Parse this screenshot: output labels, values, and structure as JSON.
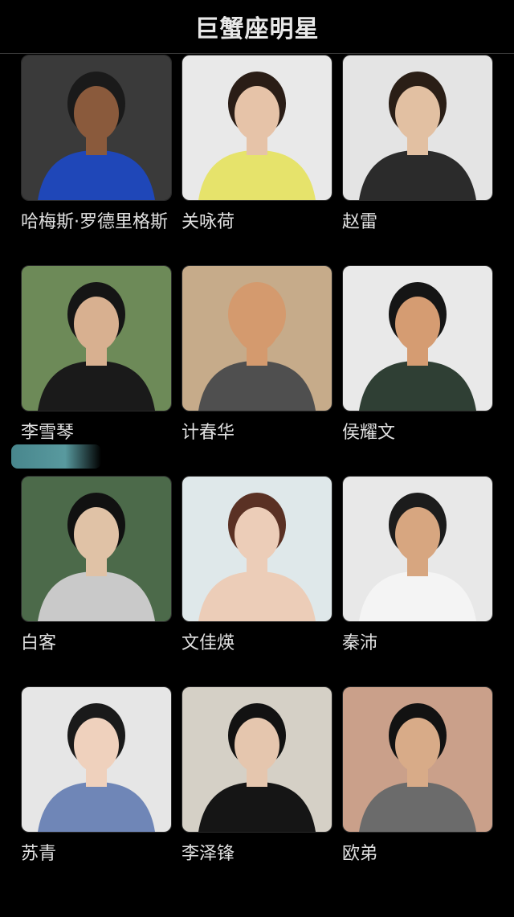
{
  "header": {
    "title": "巨蟹座明星"
  },
  "celebrities": [
    {
      "name": "哈梅斯·罗德里格斯",
      "photo": {
        "bg": "#3a3a3a",
        "skin": "#8a5a3c",
        "hair": "#1a1a1a",
        "shirt": "#1f47b8"
      }
    },
    {
      "name": "关咏荷",
      "photo": {
        "bg": "#e9e9e9",
        "skin": "#e6c3a8",
        "hair": "#2a1d16",
        "shirt": "#e6e36b"
      }
    },
    {
      "name": "赵雷",
      "photo": {
        "bg": "#e4e4e4",
        "skin": "#e2c0a2",
        "hair": "#2a1e16",
        "shirt": "#2b2b2b"
      }
    },
    {
      "name": "李雪琴",
      "photo": {
        "bg": "#6d8a58",
        "skin": "#d8b090",
        "hair": "#151515",
        "shirt": "#1a1a1a"
      }
    },
    {
      "name": "计春华",
      "photo": {
        "bg": "#c6ab8a",
        "skin": "#d49a6e",
        "hair": "#d49a6e",
        "shirt": "#4f4f4f"
      }
    },
    {
      "name": "侯耀文",
      "photo": {
        "bg": "#e9e9e9",
        "skin": "#d59c72",
        "hair": "#151515",
        "shirt": "#2f3f34"
      }
    },
    {
      "name": "白客",
      "photo": {
        "bg": "#4c6a4a",
        "skin": "#e0c2a6",
        "hair": "#111111",
        "shirt": "#c9c9c9"
      }
    },
    {
      "name": "文佳煐",
      "photo": {
        "bg": "#dfe8ea",
        "skin": "#eccdb8",
        "hair": "#5a3124",
        "shirt": "#eccdb8"
      }
    },
    {
      "name": "秦沛",
      "photo": {
        "bg": "#e8e8e8",
        "skin": "#d7a680",
        "hair": "#1c1c1c",
        "shirt": "#f4f4f4"
      }
    },
    {
      "name": "苏青",
      "photo": {
        "bg": "#e6e6e6",
        "skin": "#efd1bd",
        "hair": "#1a1a1a",
        "shirt": "#6f86b7"
      }
    },
    {
      "name": "李泽锋",
      "photo": {
        "bg": "#d5d0c6",
        "skin": "#e5c6ae",
        "hair": "#121212",
        "shirt": "#151515"
      }
    },
    {
      "name": "欧弟",
      "photo": {
        "bg": "#caa08a",
        "skin": "#d8ab88",
        "hair": "#121212",
        "shirt": "#6b6b6b"
      }
    }
  ]
}
